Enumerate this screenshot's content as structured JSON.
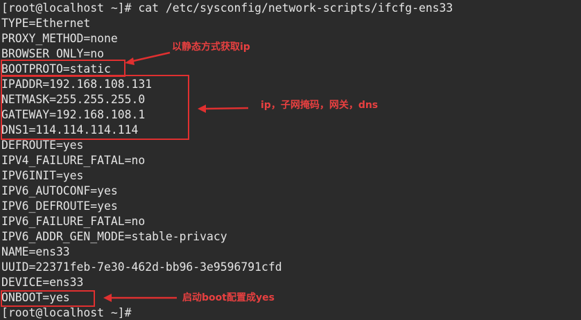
{
  "terminal": {
    "lines": [
      "[root@localhost ~]# cat /etc/sysconfig/network-scripts/ifcfg-ens33",
      "TYPE=Ethernet",
      "PROXY_METHOD=none",
      "BROWSER_ONLY=no",
      "BOOTPROTO=static",
      "IPADDR=192.168.108.131",
      "NETMASK=255.255.255.0",
      "GATEWAY=192.168.108.1",
      "DNS1=114.114.114.114",
      "DEFROUTE=yes",
      "IPV4_FAILURE_FATAL=no",
      "IPV6INIT=yes",
      "IPV6_AUTOCONF=yes",
      "IPV6_DEFROUTE=yes",
      "IPV6_FAILURE_FATAL=no",
      "IPV6_ADDR_GEN_MODE=stable-privacy",
      "NAME=ens33",
      "UUID=22371feb-7e30-462d-bb96-3e9596791cfd",
      "DEVICE=ens33",
      "ONBOOT=yes",
      "[root@localhost ~]#"
    ]
  },
  "annotations": {
    "bootproto_note": "以静态方式获取ip",
    "network_note": "ip，子网掩码，网关，dns",
    "onboot_note": "启动boot配置成yes",
    "color": "#e03030"
  }
}
